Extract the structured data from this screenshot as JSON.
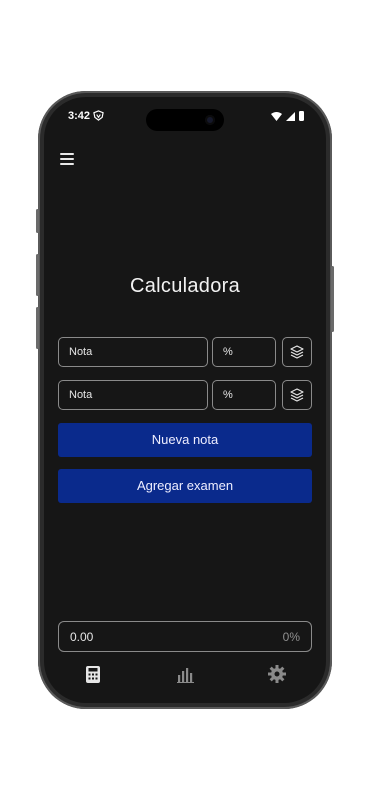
{
  "status": {
    "time": "3:42"
  },
  "app": {
    "title": "Calculadora"
  },
  "rows": [
    {
      "grade_placeholder": "Nota",
      "percent_placeholder": "%"
    },
    {
      "grade_placeholder": "Nota",
      "percent_placeholder": "%"
    }
  ],
  "actions": {
    "new_grade": "Nueva nota",
    "add_exam": "Agregar examen"
  },
  "result": {
    "value": "0.00",
    "percent": "0%"
  },
  "nav": {
    "items": [
      "calculator-icon",
      "chart-icon",
      "gear-icon"
    ]
  },
  "colors": {
    "background": "#161616",
    "primary": "#0a2a8c"
  }
}
